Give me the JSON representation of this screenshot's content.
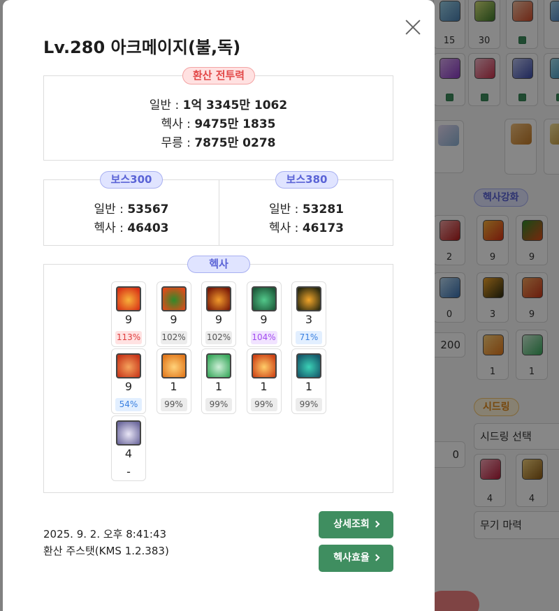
{
  "background": {
    "top_tiles": [
      {
        "num": "15"
      },
      {
        "num": "30"
      },
      {
        "num": ""
      },
      {
        "num": ""
      }
    ],
    "hexa_pill": "헥사강화",
    "hexa_tiles": [
      "2",
      "9",
      "9",
      "0",
      "3",
      "9",
      "1",
      "1"
    ],
    "input_value": "200",
    "seed_pill": "시드링",
    "seed_select": "시드링 선택",
    "seed_value": "0",
    "seed_tiles": [
      "4",
      "4"
    ],
    "weapon_label": "무기 마력"
  },
  "modal": {
    "title": "Lv.280 아크메이지(불,독)",
    "converted": {
      "label": "환산 전투력",
      "normal_label": "일반 : ",
      "normal_value": "1억 3345만 1062",
      "hexa_label": "헥사 : ",
      "hexa_value": "9475만 1835",
      "nohexa_label": "무릉 : ",
      "nohexa_value": "7875만 0278"
    },
    "boss300": {
      "label": "보스300",
      "normal_label": "일반 : ",
      "normal_value": "53567",
      "hexa_label": "헥사 : ",
      "hexa_value": "46403"
    },
    "boss380": {
      "label": "보스380",
      "normal_label": "일반 : ",
      "normal_value": "53281",
      "hexa_label": "헥사 : ",
      "hexa_value": "46173"
    },
    "hexa": {
      "label": "헥사",
      "skills": [
        {
          "level": "9",
          "pct": "113%",
          "tone": "red",
          "icon": "flame-skill-icon",
          "colors": [
            "#f8b23a",
            "#d83216"
          ]
        },
        {
          "level": "9",
          "pct": "102%",
          "tone": "gray",
          "icon": "poison-orb-skill-icon",
          "colors": [
            "#2f8a2a",
            "#e04b1a"
          ]
        },
        {
          "level": "9",
          "pct": "102%",
          "tone": "gray",
          "icon": "fire-demon-skill-icon",
          "colors": [
            "#f19a2b",
            "#7a1a08"
          ]
        },
        {
          "level": "9",
          "pct": "104%",
          "tone": "purple",
          "icon": "poison-mist-skill-icon",
          "colors": [
            "#52c88a",
            "#1e5a3a"
          ]
        },
        {
          "level": "3",
          "pct": "71%",
          "tone": "blue",
          "icon": "fire-burst-skill-icon",
          "colors": [
            "#f2a52a",
            "#2c2b10"
          ]
        },
        {
          "level": "9",
          "pct": "54%",
          "tone": "blue",
          "icon": "flame-sphere-skill-icon",
          "colors": [
            "#f5a35c",
            "#c8361a"
          ]
        },
        {
          "level": "1",
          "pct": "99%",
          "tone": "gray",
          "icon": "fire-ring-skill-icon",
          "colors": [
            "#ffd27a",
            "#e2781c"
          ]
        },
        {
          "level": "1",
          "pct": "99%",
          "tone": "gray",
          "icon": "nature-rune-skill-icon",
          "colors": [
            "#cdefd7",
            "#39a85c"
          ]
        },
        {
          "level": "1",
          "pct": "99%",
          "tone": "gray",
          "icon": "flame-wings-skill-icon",
          "colors": [
            "#ffcd69",
            "#cf4416"
          ]
        },
        {
          "level": "1",
          "pct": "99%",
          "tone": "gray",
          "icon": "venom-crystal-skill-icon",
          "colors": [
            "#3bd1b6",
            "#15596b"
          ]
        },
        {
          "level": "4",
          "pct": "-",
          "tone": "none",
          "icon": "gear-orb-skill-icon",
          "colors": [
            "#e9e6f6",
            "#6e6a9e"
          ]
        }
      ]
    },
    "date": "2025. 9. 2. 오후 8:41:43",
    "note": "환산 주스탯(KMS 1.2.383)",
    "detail_button": "상세조회",
    "hexa_button": "헥사효율"
  }
}
